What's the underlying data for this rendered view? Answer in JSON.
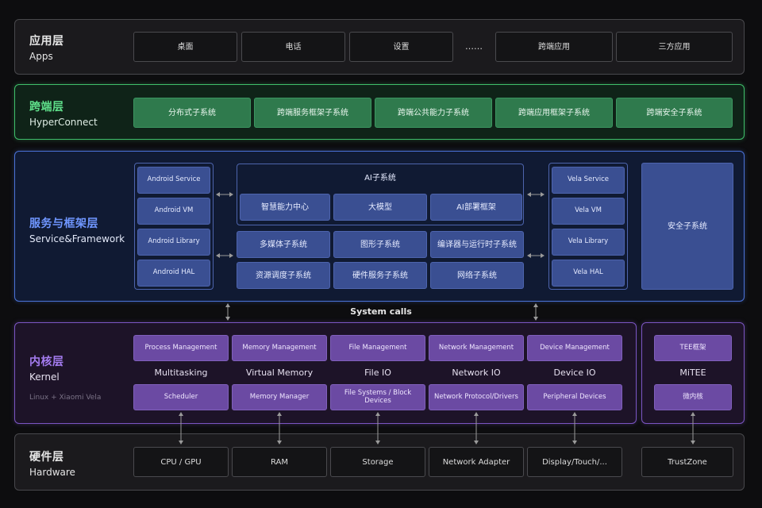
{
  "apps": {
    "title_cn": "应用层",
    "title_en": "Apps",
    "items": [
      "桌面",
      "电话",
      "设置",
      "……",
      "跨端应用",
      "三方应用"
    ]
  },
  "hyperconnect": {
    "title_cn": "跨端层",
    "title_en": "HyperConnect",
    "items": [
      "分布式子系统",
      "跨端服务框架子系统",
      "跨端公共能力子系统",
      "跨端应用框架子系统",
      "跨端安全子系统"
    ]
  },
  "service": {
    "title_cn": "服务与框架层",
    "title_en": "Service&Framework",
    "android": [
      "Android Service",
      "Android VM",
      "Android Library",
      "Android HAL"
    ],
    "ai_title": "AI子系统",
    "ai_items": [
      "智慧能力中心",
      "大模型",
      "AI部署框架"
    ],
    "mid_items": [
      "多媒体子系统",
      "图形子系统",
      "编译器与运行时子系统",
      "资源调度子系统",
      "硬件服务子系统",
      "网络子系统"
    ],
    "vela": [
      "Vela Service",
      "Vela VM",
      "Vela Library",
      "Vela HAL"
    ],
    "security": "安全子系统"
  },
  "system_calls": "System calls",
  "kernel": {
    "title_cn": "内核层",
    "title_en": "Kernel",
    "subtitle": "Linux + Xiaomi Vela",
    "columns": [
      {
        "top": "Process Management",
        "label": "Multitasking",
        "bottom": "Scheduler"
      },
      {
        "top": "Memory Management",
        "label": "Virtual Memory",
        "bottom": "Memory Manager"
      },
      {
        "top": "File Management",
        "label": "File IO",
        "bottom": "File Systems / Block Devices"
      },
      {
        "top": "Network Management",
        "label": "Network IO",
        "bottom": "Network Protocol/Drivers"
      },
      {
        "top": "Device Management",
        "label": "Device IO",
        "bottom": "Peripheral Devices"
      }
    ],
    "mitee": {
      "top": "TEE框架",
      "label": "MiTEE",
      "bottom": "微内核"
    }
  },
  "hardware": {
    "title_cn": "硬件层",
    "title_en": "Hardware",
    "items": [
      "CPU / GPU",
      "RAM",
      "Storage",
      "Network Adapter",
      "Display/Touch/...",
      "TrustZone"
    ]
  },
  "colors": {
    "apps_border": "#48484c",
    "hyperconnect_border": "#3fbf6a",
    "hyperconnect_title": "#5fe08a",
    "service_border": "#4a72d8",
    "service_title": "#6f96ff",
    "kernel_border": "#7b55c2",
    "kernel_title": "#a47cf0",
    "hardware_border": "#48484c"
  }
}
